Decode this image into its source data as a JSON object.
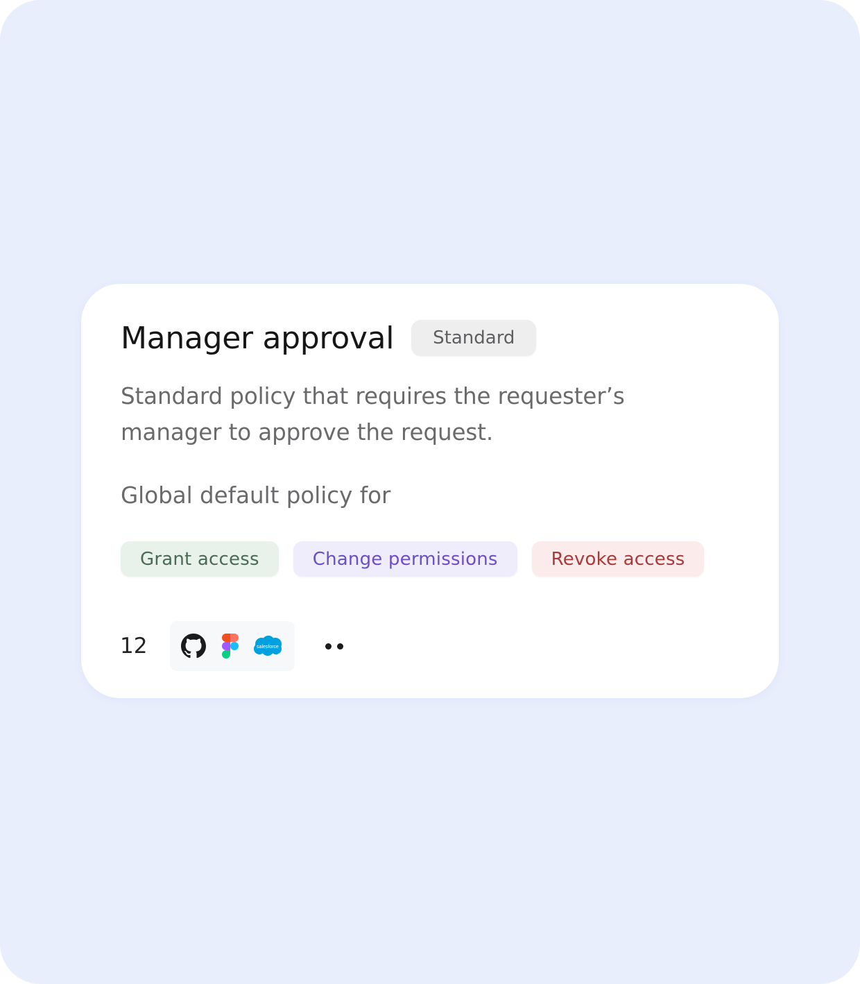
{
  "policy": {
    "title": "Manager approval",
    "badge": "Standard",
    "description": "Standard policy that requires the requester’s manager to approve the request.",
    "global_label": "Global default policy for",
    "actions": [
      {
        "label": "Grant access",
        "color": "#4a6b55",
        "background": "#e8f1ea"
      },
      {
        "label": "Change permissions",
        "color": "#6b4fc7",
        "background": "#efedfc"
      },
      {
        "label": "Revoke access",
        "color": "#a83a3a",
        "background": "#fcebeb"
      }
    ],
    "app_count": "12",
    "apps": [
      {
        "icon": "github-icon"
      },
      {
        "icon": "figma-icon"
      },
      {
        "icon": "salesforce-icon",
        "text": "salesforce"
      }
    ],
    "more_icon": "more-dots-icon"
  },
  "colors": {
    "page_background": "#e9eefd",
    "card_background": "#ffffff",
    "title": "#161616",
    "body_text": "#6a6a6d"
  }
}
